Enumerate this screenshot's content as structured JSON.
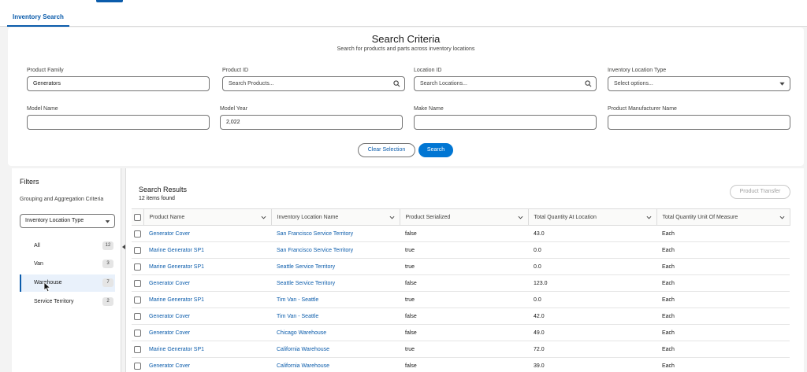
{
  "tab": {
    "label": "Inventory Search"
  },
  "criteria": {
    "title": "Search Criteria",
    "subtitle": "Search for products and parts across inventory locations",
    "product_family": {
      "label": "Product Family",
      "value": "Generators"
    },
    "product_id": {
      "label": "Product ID",
      "placeholder": "Search Products..."
    },
    "location_id": {
      "label": "Location ID",
      "placeholder": "Search Locations..."
    },
    "location_type": {
      "label": "Inventory Location Type",
      "placeholder": "Select options..."
    },
    "model_name": {
      "label": "Model Name",
      "value": ""
    },
    "model_year": {
      "label": "Model Year",
      "value": "2,022"
    },
    "make_name": {
      "label": "Make Name",
      "value": ""
    },
    "manufacturer": {
      "label": "Product Manufacturer Name",
      "value": ""
    },
    "clear_label": "Clear Selection",
    "search_label": "Search"
  },
  "filters": {
    "title": "Filters",
    "grouping_label": "Grouping and Aggregation Criteria",
    "grouping_value": "Inventory Location Type",
    "items": [
      {
        "label": "All",
        "count": "12"
      },
      {
        "label": "Van",
        "count": "3"
      },
      {
        "label": "Warehouse",
        "count": "7"
      },
      {
        "label": "Service Territory",
        "count": "2"
      }
    ]
  },
  "results": {
    "title": "Search Results",
    "count": "12 items found",
    "transfer_label": "Product Transfer",
    "columns": [
      "Product Name",
      "Inventory Location Name",
      "Product Serialized",
      "Total Quantity At Location",
      "Total Quantity Unit Of Measure"
    ],
    "rows": [
      [
        "Generator Cover",
        "San Francisco Service Territory",
        "false",
        "43.0",
        "Each"
      ],
      [
        "Marine Generator SP1",
        "San Francisco Service Territory",
        "true",
        "0.0",
        "Each"
      ],
      [
        "Marine Generator SP1",
        "Seattle Service Territory",
        "true",
        "0.0",
        "Each"
      ],
      [
        "Generator Cover",
        "Seattle Service Territory",
        "false",
        "123.0",
        "Each"
      ],
      [
        "Marine Generator SP1",
        "Tim Van - Seattle",
        "true",
        "0.0",
        "Each"
      ],
      [
        "Generator Cover",
        "Tim Van - Seattle",
        "false",
        "42.0",
        "Each"
      ],
      [
        "Generator Cover",
        "Chicago Warehouse",
        "false",
        "49.0",
        "Each"
      ],
      [
        "Marine Generator SP1",
        "California Warehouse",
        "true",
        "72.0",
        "Each"
      ],
      [
        "Generator Cover",
        "California Warehouse",
        "false",
        "39.0",
        "Each"
      ]
    ]
  }
}
